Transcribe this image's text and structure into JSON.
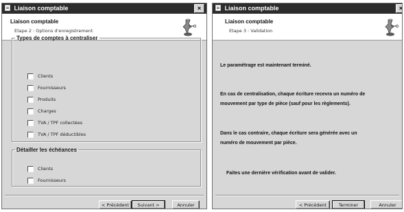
{
  "dialog1": {
    "title": "Liaison comptable",
    "close_symbol": "×",
    "header_title": "Liaison comptable",
    "header_subtitle": "Etape 2 : Options d'enregistrement",
    "group_types": {
      "legend": "Types de comptes à centraliser",
      "items": [
        "Clients",
        "Fournisseurs",
        "Produits",
        "Charges",
        "TVA / TPF collectées",
        "TVA / TPF déductibles"
      ]
    },
    "group_echeances": {
      "legend": "Détailler les échéances",
      "items": [
        "Clients",
        "Fournisseurs"
      ]
    },
    "buttons": {
      "prev": "< Précédent",
      "next": "Suivant >",
      "cancel": "Annuler"
    }
  },
  "dialog2": {
    "title": "Liaison comptable",
    "close_symbol": "×",
    "header_title": "Liaison comptable",
    "header_subtitle": "Etape 3 : Validation",
    "paragraphs": {
      "p1": "Le paramétrage est maintenant terminé.",
      "p2_line1": "En cas de centralisation, chaque écriture recevra un numéro de",
      "p2_line2": "mouvement par type de pièce (sauf pour les règlements).",
      "p3_line1": "Dans le cas contraire, chaque écriture sera générée avec un",
      "p3_line2": "numéro de mouvement par pièce.",
      "p4": "Faites une dernière vérification avant de valider."
    },
    "buttons": {
      "prev": "< Précédent",
      "finish": "Terminer",
      "cancel": "Annuler"
    }
  },
  "icons": {
    "title": "application-icon",
    "wizard": "wizard-icon"
  }
}
